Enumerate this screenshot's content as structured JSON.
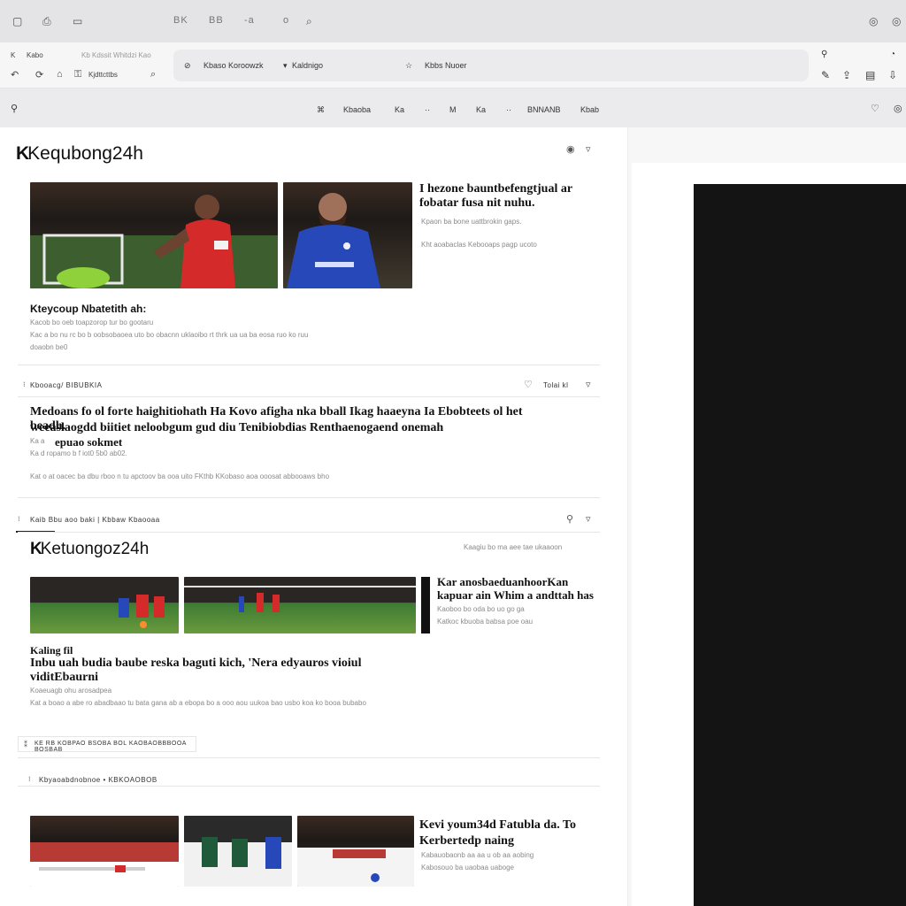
{
  "chrome": {
    "top_icons": [
      "window-icon",
      "bookmark-icon",
      "folder-icon"
    ],
    "tab_texts": [
      "BK",
      "BB",
      "-a",
      "o"
    ],
    "right_icons": [
      "menu-icon",
      "close-icon"
    ]
  },
  "toolbar": {
    "left_label_1": "K",
    "left_label_2": "Kabo",
    "left_label_3": "Kb Kdssit Whitdzi Kao",
    "left_label_4": "Kjdttcttbs",
    "omnibox_segment_1": "Kbaso Koroowzk",
    "omnibox_segment_2": "Kaldnigo",
    "omnibox_segment_3": "Kbbs Nuoer"
  },
  "nav": {
    "items": [
      "Kbaoba",
      "Ka",
      "M",
      "Ka",
      "BNNANB",
      "Kbab"
    ]
  },
  "site": {
    "logo_top": "Kequbong24h",
    "logo_mid": "Ketuongoz24h"
  },
  "story1": {
    "side_title": "I hezone bauntbefengtjual ar fobatar fusa nit nuhu.",
    "side_meta_1": "Kpaon ba bone uattbrokin gaps.",
    "side_meta_2": "Kht aoabaclas Kebooaps pagp ucoto",
    "caption_title": "Kteycoup Nbatetith ah:",
    "caption_line_1": "Kacob bo oeb toapzorop tur bo gootaru",
    "caption_line_2": "Kac a bo nu rc bo b oobsobaoea uto bo obacnn uklaoibo rt thrk ua ua ba eosa ruo ko ruu",
    "caption_line_3": "doaobn be0"
  },
  "section1": {
    "label_left": "Kbooacg/ BIBUBKIA",
    "label_right": "Tolai kl"
  },
  "story2": {
    "headline_1": "Medoans fo ol forte haighitiohath Ha Kovo afigha nka bball Ikag haaeyna Ia Ebobteets ol het beadh.",
    "headline_2": "weeaslaogdd biitiet neloobgum gud diu Tenibiobdias Renthaenogaend onemah",
    "byline_1": "Ka a",
    "byline_2": "epuao sokmet",
    "meta_1": "Ka d ropamo b f iot0 5b0 ab02.",
    "meta_2": "Kat o at oacec ba dbu rboo n tu apctoov ba ooa uito FKthb KKobaso aoa ooosat abbooaws bho"
  },
  "section2": {
    "label": "Kaib Bbu aoo baki | Kbbaw Kbaooaa",
    "mid_meta": "Kaagiu bo ma aee tae ukaaoon"
  },
  "story3": {
    "side_title": "Kar anosbaeduanhoorKan kapuar ain Whim a andttah has",
    "side_meta_1": "Kaoboo bo oda bo uo go ga",
    "side_meta_2": "Katkoc kbuoba babsa poe oau",
    "kicker": "Kaling fil",
    "headline": "Inbu uah budia baube reska baguti kich, 'Nera edyauros vioiul viditEbaurni",
    "meta_1": "Koaeuagb ohu arosadpea",
    "meta_2": "Kat a boao a abe ro abadbaao tu bata gana ab a ebopa bo a ooo aou uukoa bao usbo koa ko booa bubabo"
  },
  "section3": {
    "label": "KE RB KOBPAO BSOBA BOL KAOBAOBBBOOA BOSBAB"
  },
  "section4": {
    "label": "Kbyaoabdnobnoe • KBKOAOBOB"
  },
  "story4": {
    "side_title": "Kevi youm34d Fatubla da. To Kerbertedp naing",
    "side_meta_1": "Kabauobaonb aa aa u ob aa aobing",
    "side_meta_2": "Kabosouo ba uaobaa uaboge"
  },
  "colors": {
    "chrome_bg": "#e4e4e6",
    "dark_panel": "#141414",
    "red_kit": "#d42a2a",
    "blue_kit": "#2648b8"
  }
}
